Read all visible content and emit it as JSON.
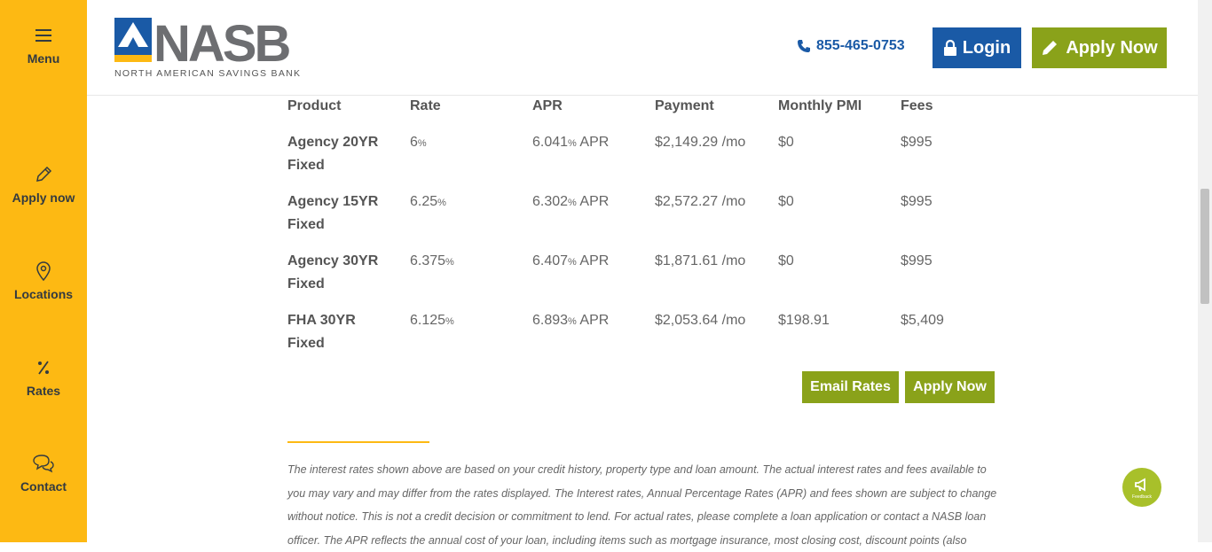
{
  "sidebar": {
    "items": [
      {
        "label": "Menu",
        "icon": "hamburger-icon"
      },
      {
        "label": "Apply now",
        "icon": "pencil-icon"
      },
      {
        "label": "Locations",
        "icon": "map-pin-icon"
      },
      {
        "label": "Rates",
        "icon": "percent-icon"
      },
      {
        "label": "Contact",
        "icon": "chat-icon"
      }
    ]
  },
  "header": {
    "logo_text": "NASB",
    "logo_subtext": "NORTH AMERICAN SAVINGS BANK",
    "phone": "855-465-0753",
    "login_label": "Login",
    "apply_label": "Apply Now"
  },
  "rates_table": {
    "headers": [
      "Product",
      "Rate",
      "APR",
      "Payment",
      "Monthly PMI",
      "Fees"
    ],
    "rows": [
      {
        "product_line1": "Agency 20YR",
        "product_line2": "Fixed",
        "rate": "6",
        "apr": "6.041",
        "payment": "$2,149.29 /mo",
        "pmi": "$0",
        "fees": "$995"
      },
      {
        "product_line1": "Agency 15YR",
        "product_line2": "Fixed",
        "rate": "6.25",
        "apr": "6.302",
        "payment": "$2,572.27 /mo",
        "pmi": "$0",
        "fees": "$995"
      },
      {
        "product_line1": "Agency 30YR",
        "product_line2": "Fixed",
        "rate": "6.375",
        "apr": "6.407",
        "payment": "$1,871.61 /mo",
        "pmi": "$0",
        "fees": "$995"
      },
      {
        "product_line1": "FHA 30YR",
        "product_line2": "Fixed",
        "rate": "6.125",
        "apr": "6.893",
        "payment": "$2,053.64 /mo",
        "pmi": "$198.91",
        "fees": "$5,409"
      }
    ],
    "percent_sign": "%",
    "apr_suffix": " APR"
  },
  "actions": {
    "email_rates_label": "Email Rates",
    "apply_now_label": "Apply Now"
  },
  "disclaimer": "The interest rates shown above are based on your credit history, property type and loan amount. The actual interest rates and fees available to you may vary and may differ from the rates displayed. The Interest rates, Annual Percentage Rates (APR) and fees shown are subject to change without notice. This is not a credit decision or commitment to lend. For actual rates, please complete a loan application or contact a NASB loan officer. The APR reflects the annual cost of your loan, including items such as mortgage insurance, most closing cost, discount points (also",
  "feedback": {
    "label": "Feedback"
  },
  "colors": {
    "sidebar": "#fdb913",
    "brand_blue": "#1a5aa6",
    "brand_green": "#8aa21a"
  }
}
